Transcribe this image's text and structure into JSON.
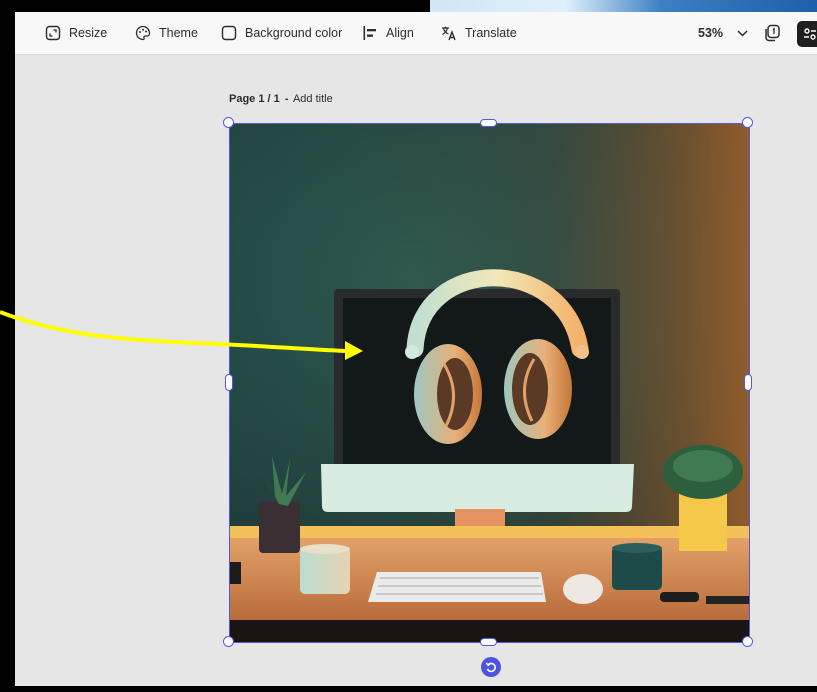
{
  "toolbar": {
    "resize_label": "Resize",
    "theme_label": "Theme",
    "background_label": "Background color",
    "align_label": "Align",
    "translate_label": "Translate",
    "zoom_value": "53%"
  },
  "page": {
    "page_indicator": "Page 1 / 1",
    "separator": "-",
    "title_placeholder": "Add title"
  },
  "icons": {
    "resize": "resize-icon",
    "theme": "palette-icon",
    "background": "square-outline-icon",
    "align": "align-left-icon",
    "translate": "translate-icon",
    "zoom_dropdown": "chevron-down-icon",
    "pages": "pages-icon",
    "rotate": "rotate-icon"
  },
  "colors": {
    "selection": "#5258e4",
    "annotation_arrow": "#ffff00",
    "toolbar_bg": "#f8f8f8",
    "workspace_bg": "#e6e6e6"
  }
}
